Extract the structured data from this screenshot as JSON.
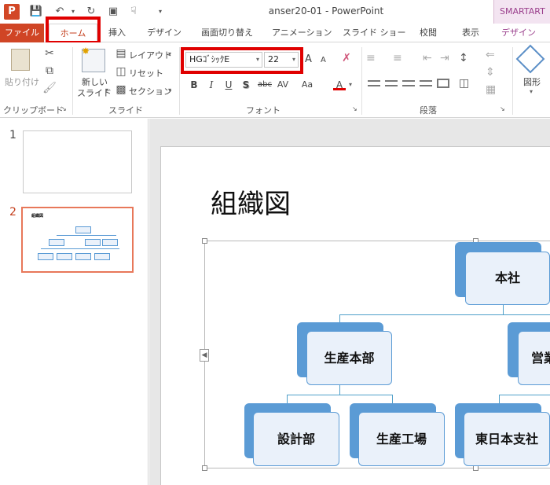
{
  "window": {
    "title": "anser20-01 - PowerPoint",
    "contextual_tab": "SMARTART"
  },
  "qat": {
    "save_icon": "save-icon",
    "undo_icon": "undo-icon",
    "redo_icon": "redo-icon"
  },
  "tabs": [
    "ファイル",
    "ホーム",
    "挿入",
    "デザイン",
    "画面切り替え",
    "アニメーション",
    "スライド ショー",
    "校閲",
    "表示",
    "デザイン"
  ],
  "ribbon": {
    "clipboard": {
      "paste": "貼り付け",
      "label": "クリップボード"
    },
    "slides": {
      "new_slide_line1": "新しい",
      "new_slide_line2": "スライド",
      "layout": "レイアウト",
      "reset": "リセット",
      "section": "セクション",
      "label": "スライド"
    },
    "font": {
      "name": "HGｺﾞｼｯｸE",
      "size": "22",
      "label": "フォント",
      "bold": "B",
      "italic": "I",
      "underline": "U",
      "shadow": "S",
      "strike": "abc",
      "spacing": "AV",
      "case": "Aa",
      "color": "A",
      "grow": "A",
      "shrink": "A"
    },
    "paragraph": {
      "label": "段落"
    },
    "drawing": {
      "shape": "図形"
    }
  },
  "thumbnails": [
    {
      "number": "1"
    },
    {
      "number": "2",
      "title": "組織図"
    }
  ],
  "slide": {
    "title": "組織図",
    "nodes": {
      "root": "本社",
      "level2_left": "生産本部",
      "level2_right": "営業",
      "level3_1": "設計部",
      "level3_2": "生産工場",
      "level3_3": "東日本支社"
    }
  },
  "colors": {
    "accent": "#d04525",
    "highlight": "#e00000",
    "node_fill": "#5b9bd5",
    "node_front": "#eaf1fa"
  }
}
